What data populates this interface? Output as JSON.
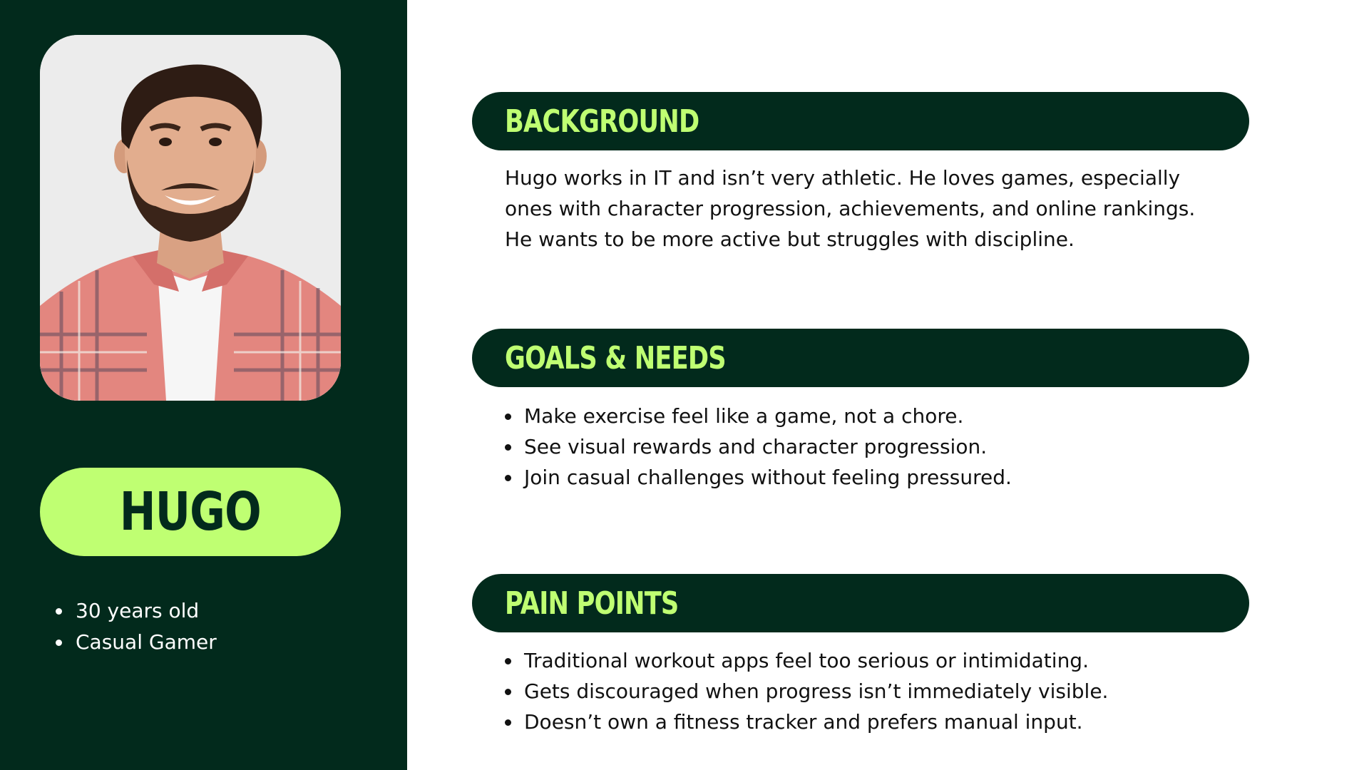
{
  "persona": {
    "name": "HUGO",
    "traits": [
      "30 years old",
      "Casual Gamer"
    ],
    "photo_icon": "portrait-photo"
  },
  "sections": {
    "background": {
      "title": "BACKGROUND",
      "text": "Hugo works in IT and isn’t very athletic. He loves games, especially ones with character progression, achievements, and online rankings. He wants to be more active but struggles with discipline."
    },
    "goals": {
      "title": "GOALS & NEEDS",
      "items": [
        "Make exercise feel like a game, not a chore.",
        "See visual rewards and character progression.",
        "Join casual challenges without feeling pressured."
      ]
    },
    "pain_points": {
      "title": "PAIN POINTS",
      "items": [
        "Traditional workout apps feel too serious or intimidating.",
        "Gets discouraged when progress isn’t immediately visible.",
        "Doesn’t own a fitness tracker and prefers manual input."
      ]
    }
  },
  "colors": {
    "dark_green": "#022a1c",
    "lime": "#bfff72",
    "background": "#ffffff"
  }
}
